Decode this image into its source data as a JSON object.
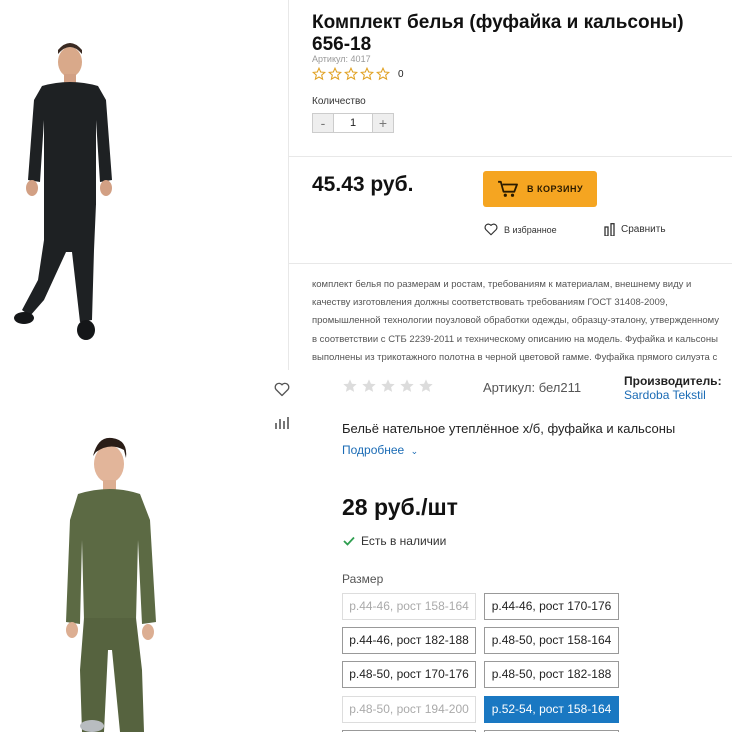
{
  "top": {
    "title": "Комплект белья (фуфайка и кальсоны) 656-18",
    "sku": "Артикул: 4017",
    "rating_count": "0",
    "quantity_label": "Количество",
    "stepper": {
      "minus": "-",
      "value": "1",
      "plus": "+"
    },
    "price": "45.43 руб.",
    "cart_label": "В КОРЗИНУ",
    "favorite_label": "В избранное",
    "compare_label": "Сравнить",
    "description": "комплект белья по размерам и ростам, требованиям к материалам, внешнему виду и качеству изготовления должны соответствовать требованиям ГОСТ 31408-2009, промышленной технологии поузловой обработки одежды, образцу-эталону, утвержденному в соответствии с СТБ 2239-2011 и техническому описанию на модель. Фуфайка и кальсоны выполнены из трикотажного полотна в черной цветовой гамме. Фуфайка прямого силуэта с длинными рукавами.",
    "colors": {
      "accent": "#f5a521",
      "garment": "#1e2123",
      "star_outline": "#e0a020"
    }
  },
  "bottom": {
    "sku": "Артикул: бел211",
    "maker_label": "Производитель:",
    "maker": "Sardoba Tekstil",
    "description": "Бельё нательное утеплённое х/б, фуфайка и кальсоны",
    "more_link": "Подробнее",
    "price": "28 руб./шт",
    "stock": "Есть в наличии",
    "size_label": "Размер",
    "sizes": [
      {
        "label": "р.44-46, рост 158-164",
        "state": "disabled"
      },
      {
        "label": "р.44-46, рост 170-176",
        "state": "normal"
      },
      {
        "label": "р.44-46, рост 182-188",
        "state": "normal"
      },
      {
        "label": "р.48-50, рост 158-164",
        "state": "normal"
      },
      {
        "label": "р.48-50, рост 170-176",
        "state": "normal"
      },
      {
        "label": "р.48-50, рост 182-188",
        "state": "normal"
      },
      {
        "label": "р.48-50, рост 194-200",
        "state": "disabled"
      },
      {
        "label": "р.52-54, рост 158-164",
        "state": "selected"
      }
    ],
    "colors": {
      "link": "#1a6bb5",
      "selected": "#1a78c2",
      "in_stock": "#2e9e4f",
      "garment": "#5c6a44"
    }
  }
}
